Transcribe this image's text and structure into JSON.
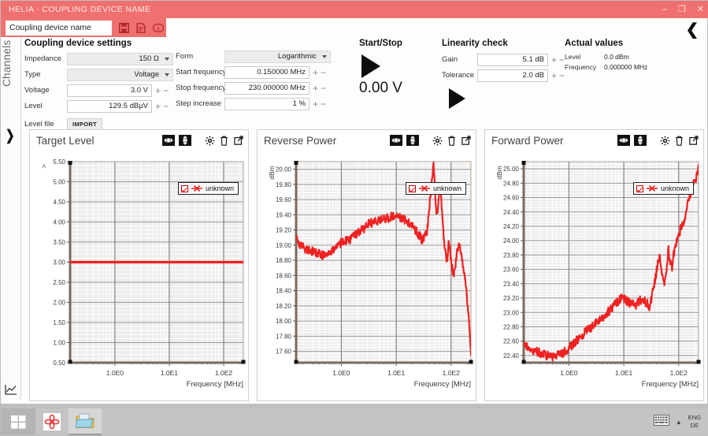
{
  "window": {
    "title": "HELIA - COUPLING DEVICE NAME",
    "minimize_label": "–",
    "restore_label": "❐",
    "close_label": "✕"
  },
  "toolbar": {
    "device_name_value": "Coupling device name",
    "device_name_placeholder": "Coupling device name",
    "save_icon": "save-icon",
    "document_icon": "document-icon",
    "clear_icon": "clear-icon"
  },
  "rail": {
    "label": "Channels",
    "expand_icon": "chevron-right-icon",
    "chart_icon": "line-chart-icon"
  },
  "back_button": {
    "label": "❮",
    "icon": "chevron-left-icon"
  },
  "settings": {
    "title": "Coupling device settings",
    "left_fields": [
      {
        "label": "Impedance",
        "value": "150 Ω",
        "type": "combo"
      },
      {
        "label": "Type",
        "value": "Voltage",
        "type": "combo"
      },
      {
        "label": "Voltage",
        "value": "3.0 V",
        "type": "stepper"
      },
      {
        "label": "Level",
        "value": "129.5 dBµV",
        "type": "stepper"
      }
    ],
    "level_file_label": "Level file",
    "import_label": "IMPORT",
    "right_fields": [
      {
        "label": "Form",
        "value": "Logarithmic",
        "type": "combo"
      },
      {
        "label": "Start frequency",
        "value": "0.150000 MHz",
        "type": "stepper"
      },
      {
        "label": "Stop frequency",
        "value": "230.000000 MHz",
        "type": "stepper"
      },
      {
        "label": "Step increase",
        "value": "1 %",
        "type": "stepper"
      }
    ]
  },
  "start_stop": {
    "title": "Start/Stop",
    "play_icon": "play-triangle-icon",
    "value": "0.00 V"
  },
  "linearity": {
    "title": "Linearity check",
    "fields": [
      {
        "label": "Gain",
        "value": "5.1 dB"
      },
      {
        "label": "Tolerance",
        "value": "2.0 dB"
      }
    ],
    "play_icon": "play-triangle-icon"
  },
  "actual_values": {
    "title": "Actual values",
    "rows": [
      {
        "key": "Level",
        "value": "0.0 dBm"
      },
      {
        "key": "Frequency",
        "value": "0.000000 MHz"
      }
    ]
  },
  "panel_icons": {
    "fit_horizontal": "fit-horizontal-icon",
    "fit_vertical": "fit-vertical-icon",
    "settings": "gear-icon",
    "delete": "trash-icon",
    "popout": "popout-icon"
  },
  "legend": {
    "label": "unknown",
    "checked": true,
    "marker_color": "#ee2222"
  },
  "taskbar": {
    "start_icon": "windows-start-icon",
    "items": [
      {
        "icon": "helia-app-icon",
        "active": false
      },
      {
        "icon": "file-explorer-icon",
        "active": true
      }
    ],
    "keyboard_icon": "keyboard-icon",
    "tray_chevron": "tray-chevron-icon",
    "language_line1": "ENG",
    "language_line2": "DE"
  },
  "colors": {
    "accent": "#f0706f",
    "trace": "#ee2222",
    "plot_bg": "#ededed",
    "axis": "#7a6a5e"
  },
  "chart_data": [
    {
      "type": "line",
      "title": "Target Level",
      "xlabel": "Frequency [MHz]",
      "ylabel": "",
      "ytick_labels": [
        "5.50",
        "5.00",
        "4.50",
        "4.00",
        "3.50",
        "3.00",
        "2.50",
        "2.00",
        "1.50",
        "1.00",
        "0.50"
      ],
      "ylim": [
        0.5,
        5.5
      ],
      "xtick_labels": [
        "1.0E0",
        "1.0E1",
        "1.0E2"
      ],
      "xlim": [
        0.15,
        230
      ],
      "xscale": "log",
      "grid": true,
      "legend": [
        "unknown"
      ],
      "legend_position": "top-right",
      "series": [
        {
          "name": "unknown",
          "x": [
            0.15,
            0.5,
            1,
            2,
            5,
            10,
            20,
            50,
            100,
            230
          ],
          "values": [
            3.0,
            3.0,
            3.0,
            3.0,
            3.0,
            3.0,
            3.0,
            3.0,
            3.0,
            3.0
          ]
        }
      ]
    },
    {
      "type": "line",
      "title": "Reverse Power",
      "xlabel": "Frequency [MHz]",
      "ylabel": "dBm",
      "ytick_labels": [
        "20.00",
        "19.80",
        "19.60",
        "19.40",
        "19.20",
        "19.00",
        "18.80",
        "18.60",
        "18.40",
        "18.20",
        "18.00",
        "17.80",
        "17.60"
      ],
      "ylim": [
        17.45,
        20.1
      ],
      "xtick_labels": [
        "1.0E0",
        "1.0E1",
        "1.0E2"
      ],
      "xlim": [
        0.15,
        230
      ],
      "xscale": "log",
      "grid": true,
      "legend": [
        "unknown"
      ],
      "legend_position": "top-right",
      "series": [
        {
          "name": "unknown",
          "x": [
            0.15,
            0.18,
            0.22,
            0.27,
            0.33,
            0.4,
            0.5,
            0.62,
            0.76,
            0.93,
            1.15,
            1.41,
            1.73,
            2.12,
            2.6,
            3.19,
            3.91,
            4.8,
            5.88,
            7.21,
            8.84,
            10.8,
            13.3,
            16.3,
            20.0,
            24.5,
            30.0,
            36.8,
            45.1,
            48.0,
            50.0,
            52.0,
            55.0,
            58.0,
            62.0,
            66.0,
            70.0,
            75.0,
            80.0,
            85.0,
            90.0,
            95.0,
            100.0,
            110.0,
            120.0,
            130.0,
            140.0,
            150.0,
            160.0,
            175.0,
            190.0,
            205.0,
            215.0,
            222.0,
            226.0,
            228.0,
            230.0
          ],
          "values": [
            19.1,
            19.0,
            18.95,
            18.93,
            18.9,
            18.88,
            18.85,
            18.88,
            18.95,
            19.02,
            19.05,
            19.06,
            19.12,
            19.18,
            19.22,
            19.28,
            19.3,
            19.33,
            19.34,
            19.36,
            19.38,
            19.37,
            19.35,
            19.3,
            19.24,
            19.16,
            19.06,
            19.2,
            19.9,
            20.05,
            19.88,
            19.55,
            19.4,
            19.52,
            19.75,
            19.6,
            19.3,
            19.05,
            18.86,
            18.82,
            19.0,
            18.95,
            18.78,
            18.6,
            18.75,
            18.95,
            19.0,
            18.92,
            18.8,
            18.62,
            18.4,
            18.1,
            17.9,
            17.75,
            17.62,
            17.55,
            17.5
          ]
        }
      ]
    },
    {
      "type": "line",
      "title": "Forward Power",
      "xlabel": "Frequency [MHz]",
      "ylabel": "dBm",
      "ytick_labels": [
        "25.00",
        "24.80",
        "24.60",
        "24.40",
        "24.20",
        "24.00",
        "23.80",
        "23.60",
        "23.40",
        "23.20",
        "23.00",
        "22.80",
        "22.60",
        "22.40"
      ],
      "ylim": [
        22.3,
        25.1
      ],
      "xtick_labels": [
        "1.0E0",
        "1.0E1",
        "1.0E2"
      ],
      "xlim": [
        0.15,
        230
      ],
      "xscale": "log",
      "grid": true,
      "legend": [
        "unknown"
      ],
      "legend_position": "top-right",
      "series": [
        {
          "name": "unknown",
          "x": [
            0.15,
            0.18,
            0.22,
            0.27,
            0.33,
            0.4,
            0.5,
            0.62,
            0.76,
            0.93,
            1.15,
            1.41,
            1.73,
            2.12,
            2.6,
            3.19,
            3.91,
            4.8,
            5.88,
            7.21,
            8.84,
            10.8,
            13.3,
            16.3,
            20.0,
            24.5,
            30.0,
            36.8,
            45.1,
            50.0,
            55.0,
            60.0,
            65.0,
            70.0,
            75.0,
            80.0,
            90.0,
            100.0,
            110.0,
            120.0,
            135.0,
            150.0,
            170.0,
            190.0,
            210.0,
            225.0,
            230.0
          ],
          "values": [
            22.58,
            22.52,
            22.48,
            22.45,
            22.42,
            22.4,
            22.38,
            22.4,
            22.43,
            22.48,
            22.55,
            22.62,
            22.68,
            22.75,
            22.8,
            22.86,
            22.92,
            22.98,
            23.05,
            23.12,
            23.2,
            23.18,
            23.12,
            23.1,
            23.18,
            23.15,
            23.08,
            23.45,
            23.8,
            23.55,
            23.4,
            23.62,
            23.88,
            23.72,
            23.6,
            23.8,
            23.95,
            24.05,
            24.18,
            24.22,
            24.38,
            24.55,
            24.7,
            24.8,
            24.88,
            24.95,
            25.05
          ]
        }
      ]
    }
  ]
}
